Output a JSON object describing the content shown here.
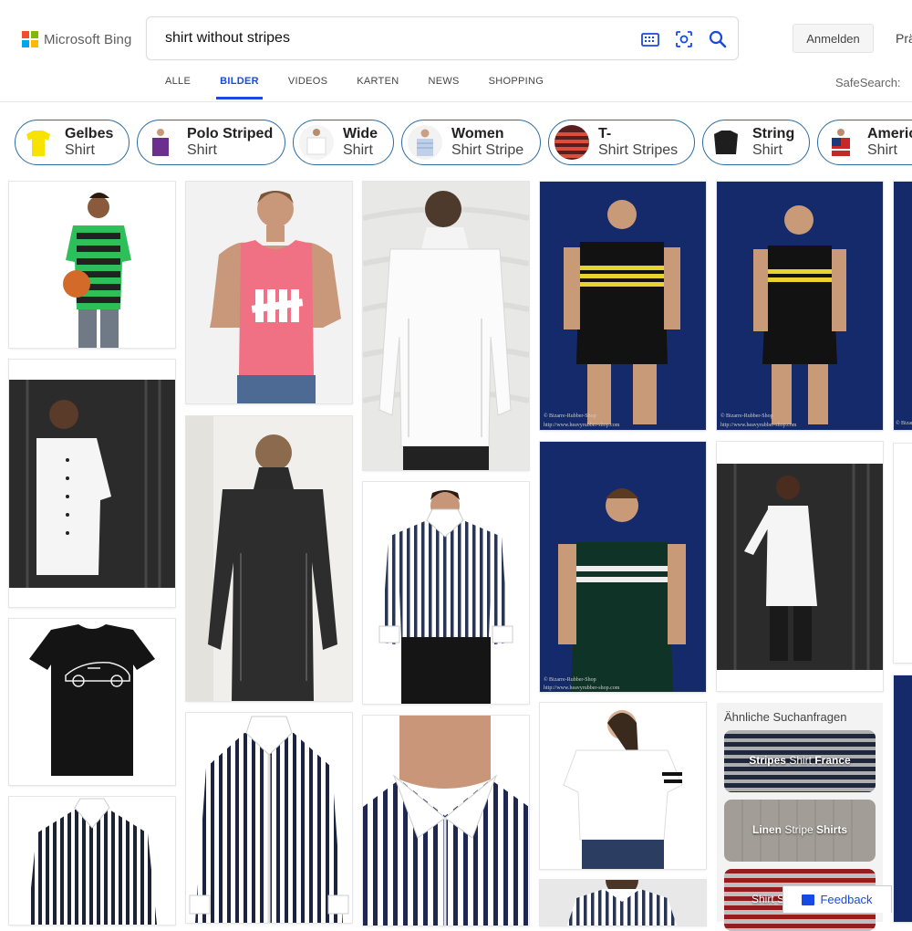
{
  "brand": {
    "name": "Microsoft Bing",
    "colors": [
      "#f25022",
      "#7fba00",
      "#00a4ef",
      "#ffb900"
    ]
  },
  "search": {
    "query": "shirt without stripes",
    "icons": [
      "visual-keyboard-icon",
      "visual-search-icon",
      "search-icon"
    ]
  },
  "header": {
    "signin_label": "Anmelden",
    "prefs_label": "Prä"
  },
  "tabs": [
    {
      "label": "ALLE",
      "active": false
    },
    {
      "label": "BILDER",
      "active": true
    },
    {
      "label": "VIDEOS",
      "active": false
    },
    {
      "label": "KARTEN",
      "active": false
    },
    {
      "label": "NEWS",
      "active": false
    },
    {
      "label": "SHOPPING",
      "active": false
    }
  ],
  "safesearch_label": "SafeSearch:",
  "pills": [
    {
      "bold": "Gelbes",
      "normal": "Shirt"
    },
    {
      "bold": "Polo Striped",
      "normal": "Shirt"
    },
    {
      "bold": "Wide",
      "normal": "Shirt"
    },
    {
      "bold": "Women",
      "normal": "Shirt Stripe"
    },
    {
      "bold": "T-",
      "normal": "Shirt Stripes"
    },
    {
      "bold": "String",
      "normal": "Shirt"
    },
    {
      "bold": "Americ",
      "normal": "Shirt"
    }
  ],
  "related": {
    "heading": "Ähnliche Suchanfragen",
    "items": [
      {
        "bold": "Stripes",
        "rest": " Shirt ",
        "bold2": "France"
      },
      {
        "bold": "Linen",
        "rest": " Stripe ",
        "bold2": "Shirts"
      },
      {
        "bold": "",
        "rest": "Shirt S",
        "bold2": ""
      }
    ]
  },
  "feedback_label": "Feedback",
  "accent": "#174ae4"
}
